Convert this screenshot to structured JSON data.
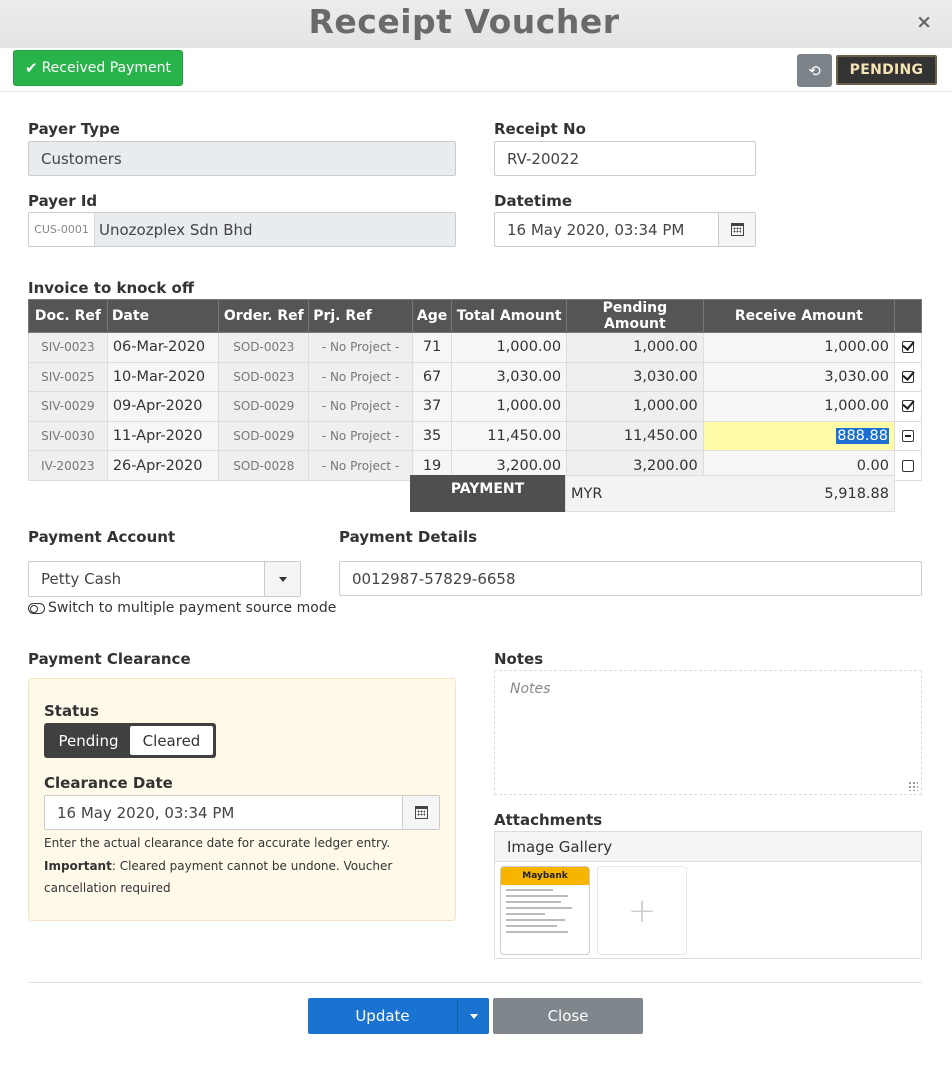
{
  "title": "Receipt Voucher",
  "close_symbol": "×",
  "toolbar": {
    "received_label": "Received Payment",
    "status_badge": "PENDING"
  },
  "form": {
    "payer_type": {
      "label": "Payer Type",
      "value": "Customers"
    },
    "receipt_no": {
      "label": "Receipt No",
      "value": "RV-20022"
    },
    "payer_id": {
      "label": "Payer Id",
      "prefix": "CUS-0001",
      "value": "Unozozplex Sdn Bhd"
    },
    "datetime": {
      "label": "Datetime",
      "value": "16 May 2020, 03:34 PM"
    }
  },
  "invoice": {
    "section_label": "Invoice to knock off",
    "columns": [
      "Doc. Ref",
      "Date",
      "Order. Ref",
      "Prj. Ref",
      "Age",
      "Total Amount",
      "Pending Amount",
      "Receive Amount"
    ],
    "rows": [
      {
        "doc_ref": "SIV-0023",
        "date": "06-Mar-2020",
        "order_ref": "SOD-0023",
        "prj_ref": "- No Project -",
        "age": "71",
        "total": "1,000.00",
        "pending": "1,000.00",
        "receive": "1,000.00",
        "check": "checked"
      },
      {
        "doc_ref": "SIV-0025",
        "date": "10-Mar-2020",
        "order_ref": "SOD-0023",
        "prj_ref": "- No Project -",
        "age": "67",
        "total": "3,030.00",
        "pending": "3,030.00",
        "receive": "3,030.00",
        "check": "checked"
      },
      {
        "doc_ref": "SIV-0029",
        "date": "09-Apr-2020",
        "order_ref": "SOD-0029",
        "prj_ref": "- No Project -",
        "age": "37",
        "total": "1,000.00",
        "pending": "1,000.00",
        "receive": "1,000.00",
        "check": "checked"
      },
      {
        "doc_ref": "SIV-0030",
        "date": "11-Apr-2020",
        "order_ref": "SOD-0029",
        "prj_ref": "- No Project -",
        "age": "35",
        "total": "11,450.00",
        "pending": "11,450.00",
        "receive": "888.88",
        "check": "partial"
      },
      {
        "doc_ref": "IV-20023",
        "date": "26-Apr-2020",
        "order_ref": "SOD-0028",
        "prj_ref": "- No Project -",
        "age": "19",
        "total": "3,200.00",
        "pending": "3,200.00",
        "receive": "0.00",
        "check": "unchecked"
      }
    ],
    "payment_label": "PAYMENT",
    "currency": "MYR",
    "payment_total": "5,918.88"
  },
  "payment_account": {
    "label": "Payment Account",
    "value": "Petty Cash",
    "switch_text": "Switch to multiple payment source mode"
  },
  "payment_details": {
    "label": "Payment Details",
    "value": "0012987-57829-6658"
  },
  "clearance": {
    "label": "Payment Clearance",
    "status_label": "Status",
    "options": [
      "Pending",
      "Cleared"
    ],
    "date_label": "Clearance Date",
    "date_value": "16 May 2020, 03:34 PM",
    "help1": "Enter the actual clearance date for accurate ledger entry.",
    "help2_bold": "Important",
    "help2": ": Cleared payment cannot be undone. Voucher cancellation required"
  },
  "notes": {
    "label": "Notes",
    "placeholder": "Notes"
  },
  "attachments": {
    "label": "Attachments",
    "gallery_title": "Image Gallery",
    "thumb_brand": "Maybank",
    "add_symbol": "+"
  },
  "footer": {
    "update_label": "Update",
    "close_label": "Close"
  },
  "colors": {
    "success": "#28b44b",
    "primary": "#1a73d1",
    "highlight": "#fdfba8",
    "panel": "#fef9e9"
  }
}
